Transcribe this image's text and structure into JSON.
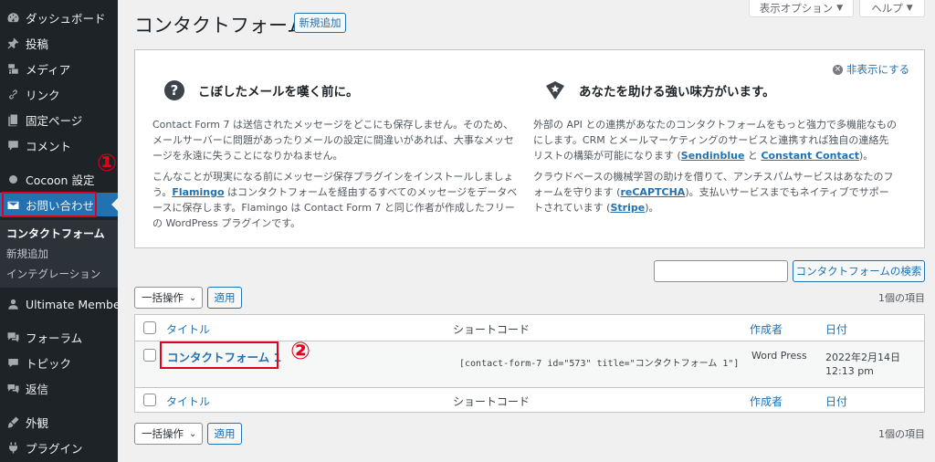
{
  "sidebar": {
    "items": [
      {
        "label": "ダッシュボード",
        "icon": "dashboard-icon"
      },
      {
        "label": "投稿",
        "icon": "pin-icon"
      },
      {
        "label": "メディア",
        "icon": "media-icon"
      },
      {
        "label": "リンク",
        "icon": "link-icon"
      },
      {
        "label": "固定ページ",
        "icon": "page-icon"
      },
      {
        "label": "コメント",
        "icon": "comment-icon"
      },
      {
        "label": "Cocoon 設定",
        "icon": "circle-icon"
      },
      {
        "label": "お問い合わせ",
        "icon": "mail-icon"
      },
      {
        "label": "Ultimate Member",
        "icon": "user-icon"
      },
      {
        "label": "フォーラム",
        "icon": "forum-icon"
      },
      {
        "label": "トピック",
        "icon": "topic-icon"
      },
      {
        "label": "返信",
        "icon": "reply-icon"
      },
      {
        "label": "外観",
        "icon": "brush-icon"
      },
      {
        "label": "プラグイン",
        "icon": "plugin-icon"
      }
    ],
    "submenu": [
      "コンタクトフォーム",
      "新規追加",
      "インテグレーション"
    ]
  },
  "annotations": {
    "one": "①",
    "two": "②"
  },
  "header": {
    "title": "コンタクトフォーム",
    "add_new": "新規追加",
    "screen_options": "表示オプション",
    "help": "ヘルプ"
  },
  "welcome": {
    "dismiss": "非表示にする",
    "left": {
      "heading": "こぼしたメールを嘆く前に。",
      "p1": "Contact Form 7 は送信されたメッセージをどこにも保存しません。そのため、メールサーバーに問題があったりメールの設定に間違いがあれば、大事なメッセージを永遠に失うことになりかねません。",
      "p2_a": "こんなことが現実になる前にメッセージ保存プラグインをインストールしましょう。",
      "p2_link": "Flamingo",
      "p2_b": " はコンタクトフォームを経由するすべてのメッセージをデータベースに保存します。Flamingo は Contact Form 7 と同じ作者が作成したフリーの WordPress プラグインです。"
    },
    "right": {
      "heading": "あなたを助ける強い味方がいます。",
      "p1_a": "外部の API との連携があなたのコンタクトフォームをもっと強力で多機能なものにします。CRM とメールマーケティングのサービスと連携すれば独自の連絡先リストの構築が可能になります (",
      "p1_link1": "Sendinblue",
      "p1_mid": " と ",
      "p1_link2": "Constant Contact",
      "p1_b": ")。",
      "p2_a": "クラウドベースの機械学習の助けを借りて、アンチスパムサービスはあなたのフォームを守ります (",
      "p2_link1": "reCAPTCHA",
      "p2_mid": ")。支払いサービスまでもネイティブでサポートされています (",
      "p2_link2": "Stripe",
      "p2_b": ")。"
    }
  },
  "search": {
    "button": "コンタクトフォームの検索",
    "value": ""
  },
  "tablenav": {
    "bulk": "一括操作",
    "apply": "適用",
    "count": "1個の項目"
  },
  "table": {
    "columns": [
      "タイトル",
      "ショートコード",
      "作成者",
      "日付"
    ],
    "rows": [
      {
        "title": "コンタクトフォーム 1",
        "shortcode": "[contact-form-7 id=\"573\" title=\"コンタクトフォーム 1\"]",
        "author": "Word Press",
        "date": "2022年2月14日",
        "time": "12:13 pm"
      }
    ]
  },
  "colors": {
    "sidebar": "#1d2327",
    "active": "#2271b1",
    "link": "#2271b1",
    "annotation": "#e3001b"
  }
}
